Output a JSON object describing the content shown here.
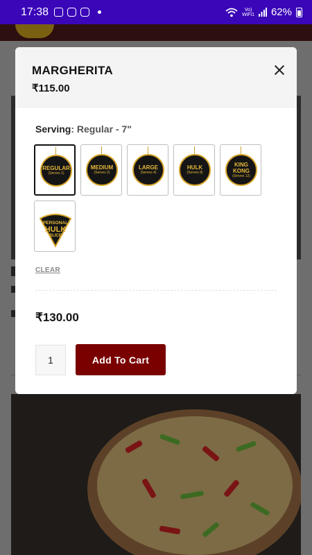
{
  "status_bar": {
    "time": "17:38",
    "volte_line1": "Vo)",
    "volte_line2": "WiFi1",
    "battery": "62%"
  },
  "modal": {
    "title": "MARGHERITA",
    "base_price": "₹115.00",
    "serving_label": "Serving",
    "serving_value": ": Regular - 7\"",
    "sizes": [
      {
        "name": "REGULAR",
        "sub": "(Serves 1)",
        "selected": true
      },
      {
        "name": "MEDIUM",
        "sub": "(Serves 2)",
        "selected": false
      },
      {
        "name": "LARGE",
        "sub": "(Serves 4)",
        "selected": false
      },
      {
        "name": "HULK",
        "sub": "(Serves 8)",
        "selected": false
      },
      {
        "name": "KING KONG",
        "sub": "(Serves 12)",
        "selected": false
      },
      {
        "name": "PERSONAL HULK SLICE",
        "sub": "",
        "selected": false
      }
    ],
    "slice_line1": "PERSONAL",
    "slice_line2": "HULK",
    "slice_line3": "SLICE",
    "clear_label": "CLEAR",
    "total_price": "₹130.00",
    "quantity": "1",
    "add_to_cart_label": "Add To Cart"
  },
  "colors": {
    "status_bar": "#3a06b8",
    "accent_button": "#7a0000",
    "badge_gold": "#d6a52a"
  }
}
